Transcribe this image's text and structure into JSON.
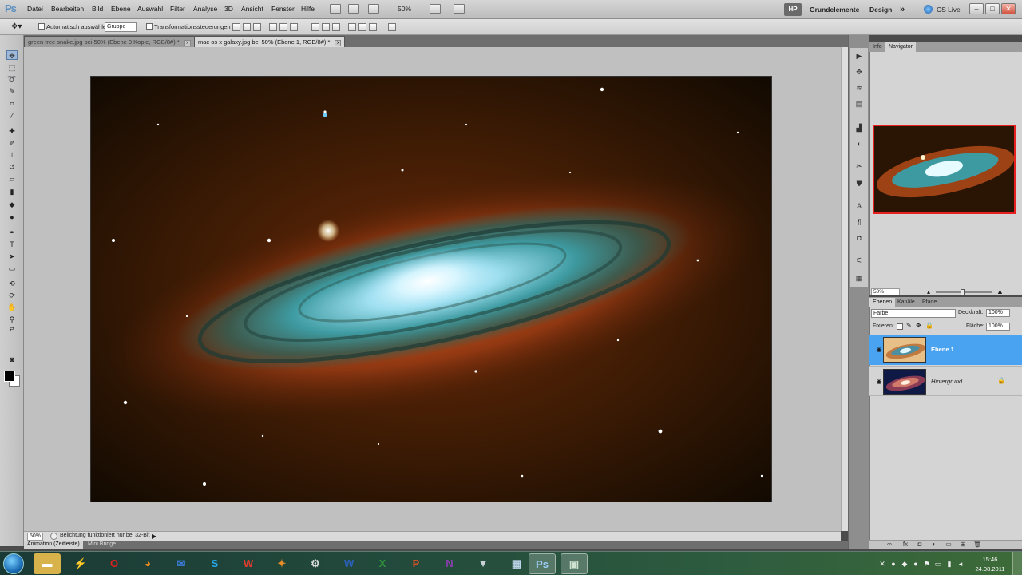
{
  "app": {
    "logo": "Ps"
  },
  "menubar": {
    "items": [
      "Datei",
      "Bearbeiten",
      "Bild",
      "Ebene",
      "Auswahl",
      "Filter",
      "Analyse",
      "3D",
      "Ansicht",
      "Fenster",
      "Hilfe"
    ],
    "zoom": "50%",
    "workspace_badge": "HP",
    "workspace_essentials": "Grundelemente",
    "workspace_design": "Design",
    "more": "»",
    "cs_live": "CS Live",
    "window_controls": [
      "–",
      "□",
      "✕"
    ]
  },
  "options_bar": {
    "auto_select_label": "Automatisch auswählen:",
    "auto_select_value": "Gruppe",
    "transform_controls_label": "Transformationssteuerungen"
  },
  "tabs": [
    {
      "label": "green tree snake.jpg bei 50% (Ebene 0 Kopie, RGB/8#) *",
      "active": false
    },
    {
      "label": "mac os x galaxy.jpg bei 50% (Ebene 1, RGB/8#) *",
      "active": true
    }
  ],
  "status": {
    "zoom": "50%",
    "message": "Belichtung funktioniert nur bei 32-Bit"
  },
  "bottom_panels": {
    "animation": "Animation (Zeitleiste)",
    "mini_bridge": "Mini Bridge"
  },
  "navigator": {
    "tabs": [
      "Info",
      "Navigator"
    ],
    "active_tab": "Navigator",
    "zoom": "50%"
  },
  "layers": {
    "tabs": [
      "Ebenen",
      "Kanäle",
      "Pfade"
    ],
    "active_tab": "Ebenen",
    "blend_mode": "Farbe",
    "opacity_label": "Deckkraft:",
    "opacity_value": "100%",
    "lock_label": "Fixieren:",
    "fill_label": "Fläche:",
    "fill_value": "100%",
    "items": [
      {
        "name": "Ebene 1",
        "selected": true
      },
      {
        "name": "Hintergrund",
        "selected": false
      }
    ]
  },
  "taskbar": {
    "apps": [
      "explorer",
      "winrar",
      "opera",
      "firefox",
      "thunderbird",
      "skype",
      "office-w",
      "outlook",
      "steam",
      "word",
      "excel",
      "powerpoint",
      "onenote",
      "usb-stick",
      "calculator",
      "photoshop",
      "remote-app"
    ],
    "time": "15:46",
    "date": "24.08.2011"
  }
}
